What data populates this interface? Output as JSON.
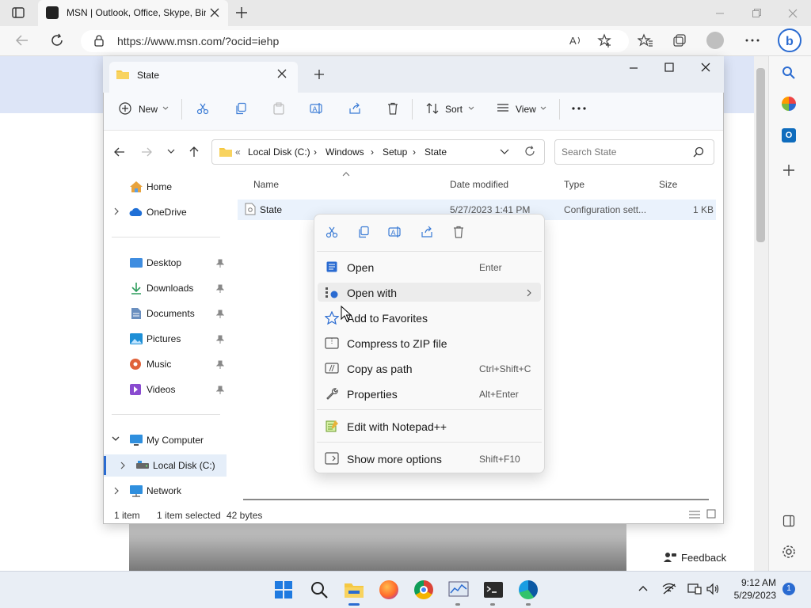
{
  "browser": {
    "tab_title": "MSN | Outlook, Office, Skype, Bing",
    "url": "https://www.msn.com/?ocid=iehp",
    "feedback_label": "Feedback"
  },
  "explorer": {
    "tab_title": "State",
    "toolbar": {
      "new_label": "New",
      "sort_label": "Sort",
      "view_label": "View"
    },
    "breadcrumbs": [
      "Local Disk (C:)",
      "Windows",
      "Setup",
      "State"
    ],
    "search_placeholder": "Search State",
    "nav": {
      "home": "Home",
      "onedrive": "OneDrive",
      "desktop": "Desktop",
      "downloads": "Downloads",
      "documents": "Documents",
      "pictures": "Pictures",
      "music": "Music",
      "videos": "Videos",
      "my_computer": "My Computer",
      "local_disk": "Local Disk (C:)",
      "network": "Network"
    },
    "columns": {
      "name": "Name",
      "date": "Date modified",
      "type": "Type",
      "size": "Size"
    },
    "file": {
      "name": "State",
      "date": "5/27/2023 1:41 PM",
      "type": "Configuration sett...",
      "size": "1 KB"
    },
    "status": {
      "items": "1 item",
      "selected": "1 item selected",
      "bytes": "42 bytes"
    }
  },
  "context_menu": {
    "items": [
      {
        "label": "Open",
        "key": "Enter"
      },
      {
        "label": "Open with",
        "key": ""
      },
      {
        "label": "Add to Favorites",
        "key": ""
      },
      {
        "label": "Compress to ZIP file",
        "key": ""
      },
      {
        "label": "Copy as path",
        "key": "Ctrl+Shift+C"
      },
      {
        "label": "Properties",
        "key": "Alt+Enter"
      },
      {
        "label": "Edit with Notepad++",
        "key": ""
      },
      {
        "label": "Show more options",
        "key": "Shift+F10"
      }
    ]
  },
  "taskbar": {
    "time": "9:12 AM",
    "date": "5/29/2023",
    "notifications": "1"
  },
  "colors": {
    "accent": "#2a6bd1",
    "folder": "#f5c842"
  }
}
